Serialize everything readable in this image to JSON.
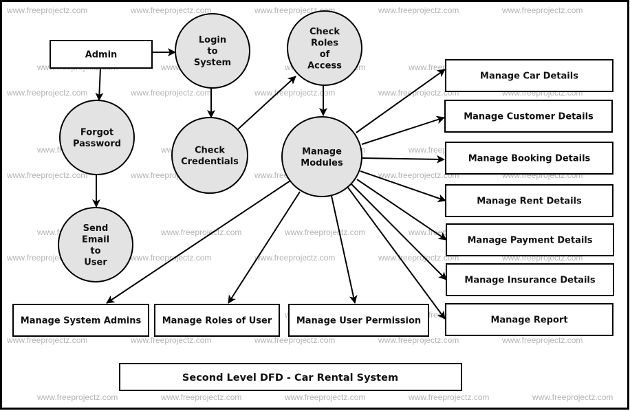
{
  "diagram": {
    "title": "Second Level DFD - Car Rental System",
    "watermark": "www.freeprojectz.com",
    "colors": {
      "process_fill": "#e3e3e3",
      "stroke": "#000000",
      "watermark": "#b4b4b4"
    },
    "entities": [
      {
        "id": "admin",
        "label": "Admin"
      }
    ],
    "processes": [
      {
        "id": "login",
        "lines": [
          "Login",
          "to",
          "System"
        ]
      },
      {
        "id": "checkRoles",
        "lines": [
          "Check",
          "Roles",
          "of",
          "Access"
        ]
      },
      {
        "id": "forgot",
        "lines": [
          "Forgot",
          "Password"
        ]
      },
      {
        "id": "checkCred",
        "lines": [
          "Check",
          "Credentials"
        ]
      },
      {
        "id": "manageModules",
        "lines": [
          "Manage",
          "Modules"
        ]
      },
      {
        "id": "sendEmail",
        "lines": [
          "Send",
          "Email",
          "to",
          "User"
        ]
      }
    ],
    "stores": [
      {
        "id": "car",
        "label": "Manage Car Details"
      },
      {
        "id": "customer",
        "label": "Manage Customer Details"
      },
      {
        "id": "booking",
        "label": "Manage Booking Details"
      },
      {
        "id": "rent",
        "label": "Manage Rent Details"
      },
      {
        "id": "payment",
        "label": "Manage Payment Details"
      },
      {
        "id": "insurance",
        "label": "Manage Insurance Details"
      },
      {
        "id": "report",
        "label": "Manage Report"
      },
      {
        "id": "sysAdmins",
        "label": "Manage System Admins"
      },
      {
        "id": "roles",
        "label": "Manage Roles of User"
      },
      {
        "id": "permission",
        "label": "Manage User Permission"
      }
    ],
    "flows": [
      {
        "from": "admin",
        "to": "login"
      },
      {
        "from": "admin",
        "to": "forgot"
      },
      {
        "from": "login",
        "to": "checkCred"
      },
      {
        "from": "checkCred",
        "to": "checkRoles"
      },
      {
        "from": "checkRoles",
        "to": "manageModules"
      },
      {
        "from": "forgot",
        "to": "sendEmail"
      },
      {
        "from": "manageModules",
        "to": "car"
      },
      {
        "from": "manageModules",
        "to": "customer"
      },
      {
        "from": "manageModules",
        "to": "booking"
      },
      {
        "from": "manageModules",
        "to": "rent"
      },
      {
        "from": "manageModules",
        "to": "payment"
      },
      {
        "from": "manageModules",
        "to": "insurance"
      },
      {
        "from": "manageModules",
        "to": "report"
      },
      {
        "from": "manageModules",
        "to": "sysAdmins"
      },
      {
        "from": "manageModules",
        "to": "roles"
      },
      {
        "from": "manageModules",
        "to": "permission"
      }
    ]
  }
}
